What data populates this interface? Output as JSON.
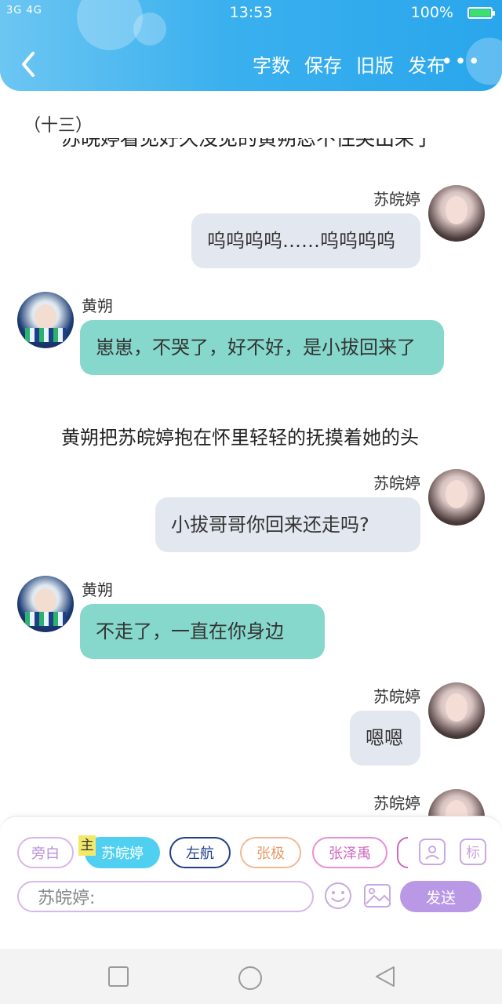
{
  "status": {
    "signal": "3G 4G",
    "time": "13:53",
    "battery": "100%"
  },
  "toolbar": {
    "word_count": "字数",
    "save": "保存",
    "old_version": "旧版",
    "publish": "发布",
    "more": "•••"
  },
  "chapter": "（十三）",
  "clipped_narration": "苏皖婷看见好久没见的黄朔忍不住哭出来了",
  "messages": [
    {
      "name": "苏皖婷",
      "text": "呜呜呜呜……呜呜呜呜"
    },
    {
      "name": "黄朔",
      "text": "崽崽，不哭了，好不好，是小拔回来了"
    },
    {
      "narration": "黄朔把苏皖婷抱在怀里轻轻的抚摸着她的头"
    },
    {
      "name": "苏皖婷",
      "text": "小拔哥哥你回来还走吗?"
    },
    {
      "name": "黄朔",
      "text": "不走了，一直在你身边"
    },
    {
      "name": "苏皖婷",
      "text": "嗯嗯"
    },
    {
      "name": "苏皖婷"
    }
  ],
  "roles": {
    "narrator": "旁白",
    "main_tag": "主",
    "selected": "苏皖婷",
    "r1": "左航",
    "r2": "张极",
    "r3": "张泽禹",
    "mark_label": "标"
  },
  "input": {
    "placeholder": "苏皖婷:",
    "send": "发送"
  },
  "colors": {
    "header": "#2aa6ec",
    "left_bubble": "#86d8cc",
    "right_bubble": "#e3e7ef",
    "send": "#b998e6"
  }
}
